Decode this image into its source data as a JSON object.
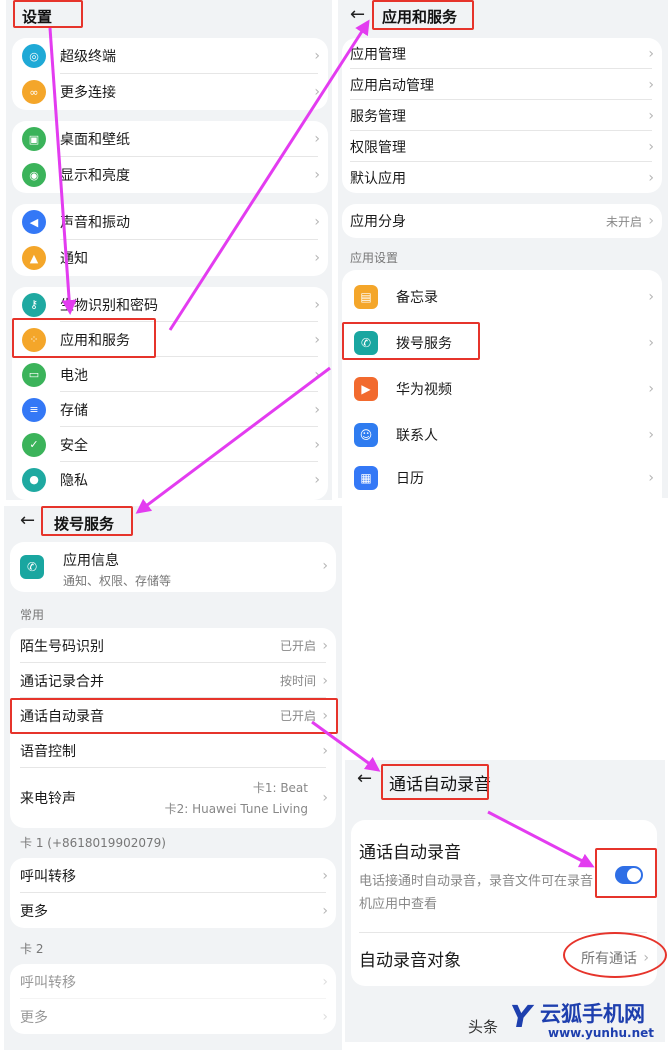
{
  "settings": {
    "title": "设置",
    "items": [
      {
        "label": "超级终端",
        "icon": "super-device-icon",
        "color": "#1fa9d6"
      },
      {
        "label": "更多连接",
        "icon": "link-icon",
        "color": "#f4a62a"
      },
      {
        "label": "桌面和壁纸",
        "icon": "wallpaper-icon",
        "color": "#3bb35a"
      },
      {
        "label": "显示和亮度",
        "icon": "eye-icon",
        "color": "#3bb35a"
      },
      {
        "label": "声音和振动",
        "icon": "speaker-icon",
        "color": "#3478f6"
      },
      {
        "label": "通知",
        "icon": "bell-icon",
        "color": "#f4a62a"
      },
      {
        "label": "生物识别和密码",
        "icon": "key-icon",
        "color": "#1fa9a1"
      },
      {
        "label": "应用和服务",
        "icon": "apps-icon",
        "color": "#f4a62a"
      },
      {
        "label": "电池",
        "icon": "battery-icon",
        "color": "#3bb35a"
      },
      {
        "label": "存储",
        "icon": "storage-icon",
        "color": "#3478f6"
      },
      {
        "label": "安全",
        "icon": "shield-icon",
        "color": "#3bb35a"
      },
      {
        "label": "隐私",
        "icon": "privacy-icon",
        "color": "#1fa9a1"
      }
    ]
  },
  "apps": {
    "title": "应用和服务",
    "group1": [
      {
        "label": "应用管理"
      },
      {
        "label": "应用启动管理"
      },
      {
        "label": "服务管理"
      },
      {
        "label": "权限管理"
      },
      {
        "label": "默认应用"
      }
    ],
    "clone": {
      "label": "应用分身",
      "value": "未开启"
    },
    "section_label": "应用设置",
    "app_list": [
      {
        "label": "备忘录",
        "icon": "memo-icon",
        "color": "#f4a62a"
      },
      {
        "label": "拨号服务",
        "icon": "phone-icon",
        "color": "#19a6a0"
      },
      {
        "label": "华为视频",
        "icon": "video-icon",
        "color": "#f26a2e"
      },
      {
        "label": "联系人",
        "icon": "contact-icon",
        "color": "#2f7cf0"
      },
      {
        "label": "日历",
        "icon": "calendar-icon",
        "color": "#3478f6"
      }
    ]
  },
  "dial": {
    "title": "拨号服务",
    "app_info": {
      "label": "应用信息",
      "sub": "通知、权限、存储等"
    },
    "section_common": "常用",
    "common": [
      {
        "label": "陌生号码识别",
        "value": "已开启"
      },
      {
        "label": "通话记录合并",
        "value": "按时间"
      },
      {
        "label": "通话自动录音",
        "value": "已开启"
      },
      {
        "label": "语音控制",
        "value": ""
      }
    ],
    "ringtone": {
      "label": "来电铃声",
      "value1": "卡1: Beat",
      "value2": "卡2: Huawei Tune Living"
    },
    "section_card1": "卡 1 (+8618019902079)",
    "card1": [
      {
        "label": "呼叫转移"
      },
      {
        "label": "更多"
      }
    ],
    "section_card2": "卡 2",
    "card2": [
      {
        "label": "呼叫转移"
      },
      {
        "label": "更多"
      }
    ]
  },
  "record": {
    "title": "通话自动录音",
    "toggle_label": "通话自动录音",
    "toggle_desc": "电话接通时自动录音，录音文件可在录音机应用中查看",
    "toggle_on": true,
    "target_label": "自动录音对象",
    "target_value": "所有通话"
  },
  "watermark": {
    "source": "头条",
    "brand": "云狐手机网",
    "url": "www.yunhu.net"
  },
  "colors": {
    "highlight": "#e6342b",
    "arrow": "#e33cf0",
    "toggle": "#2f6fe6",
    "brand": "#1e3fae"
  }
}
